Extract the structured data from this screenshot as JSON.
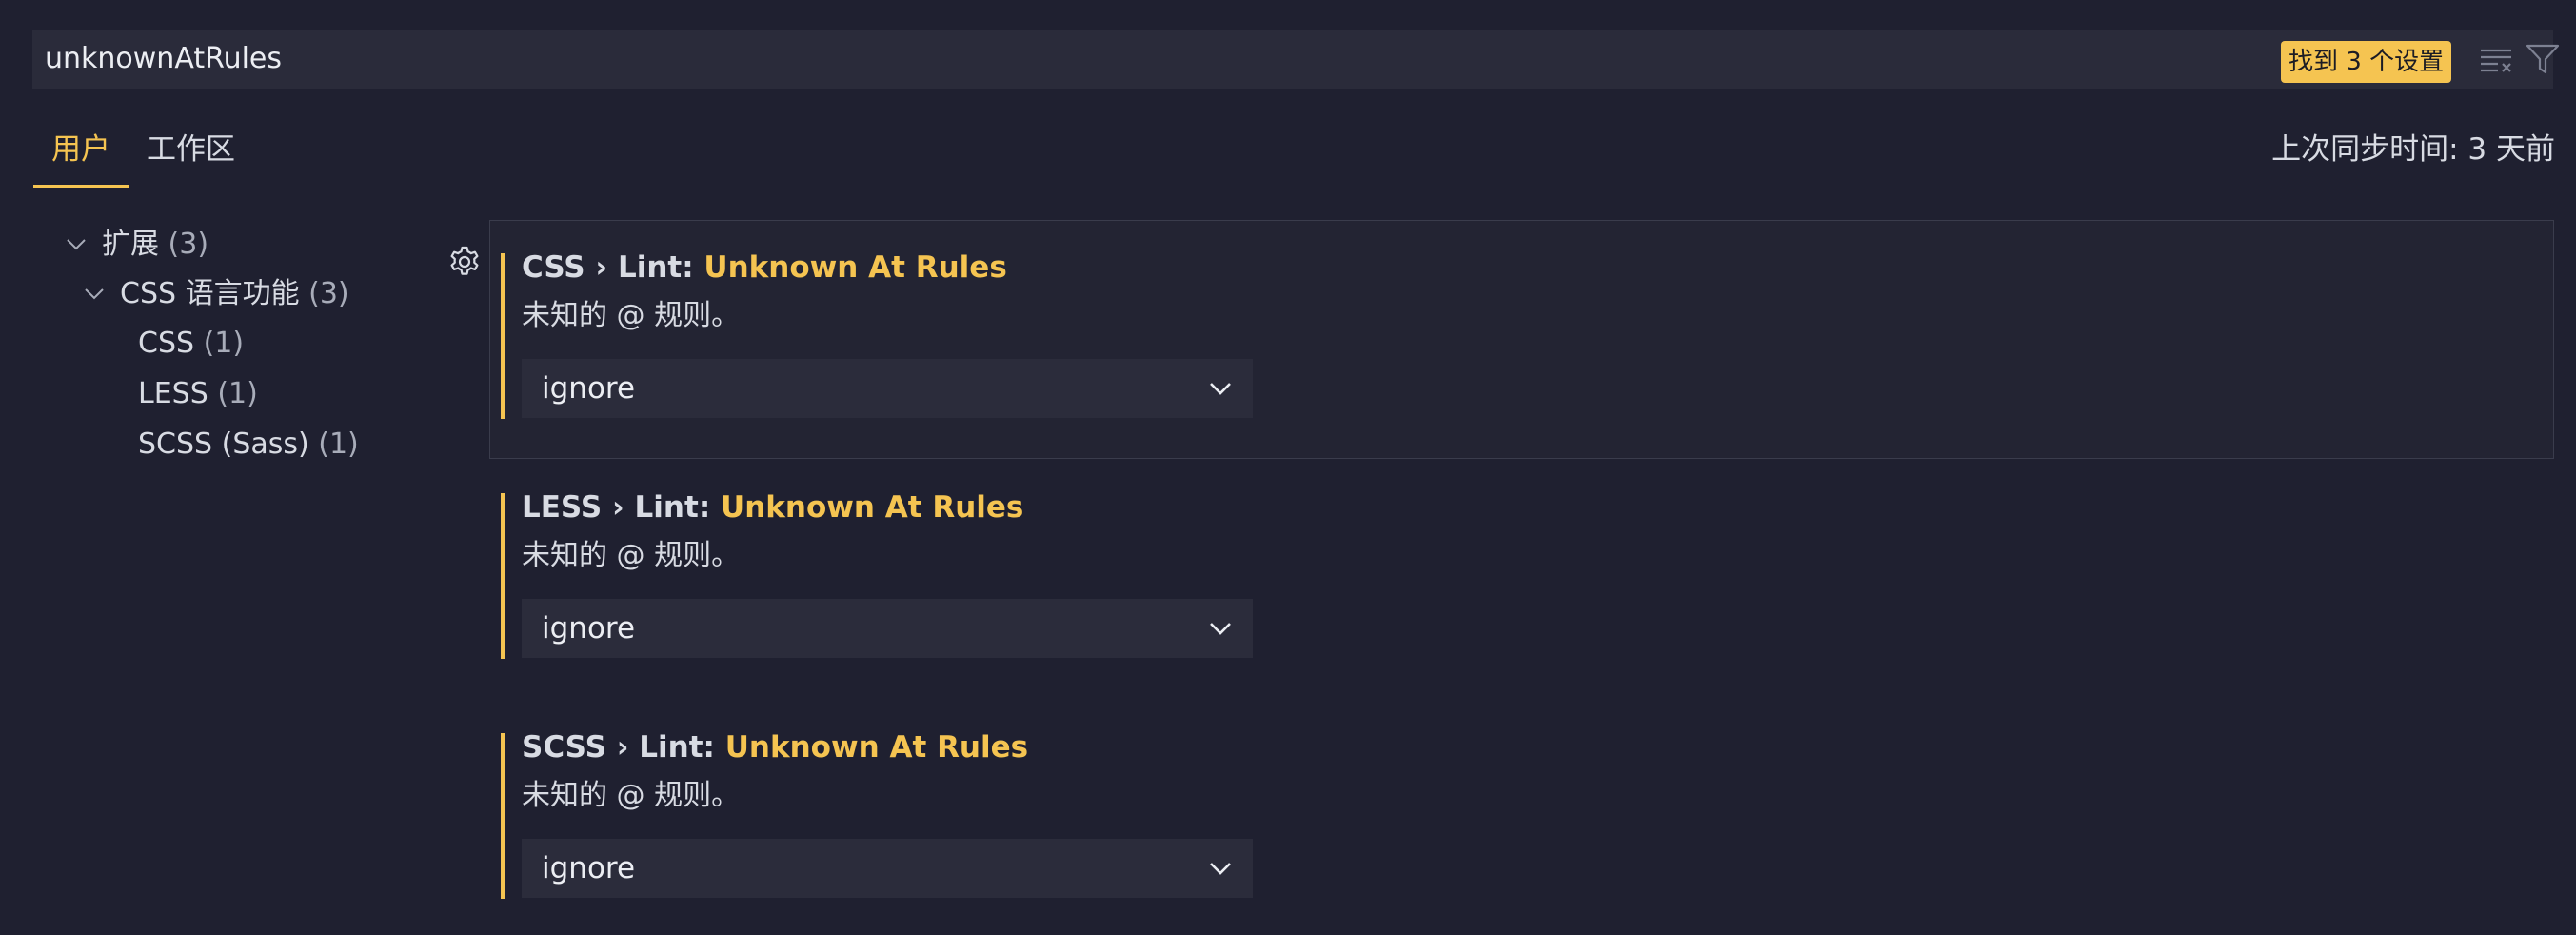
{
  "search": {
    "value": "unknownAtRules",
    "result_badge": "找到 3 个设置",
    "clear_icon": "clear-filter-icon",
    "filter_icon": "filter-icon"
  },
  "tabs": {
    "user": "用户",
    "workspace": "工作区",
    "active": "user"
  },
  "sync_status": "上次同步时间: 3 天前",
  "tree": {
    "extensions": {
      "label": "扩展",
      "count": "(3)"
    },
    "css_lang": {
      "label": "CSS 语言功能",
      "count": "(3)"
    },
    "items": [
      {
        "label": "CSS",
        "count": "(1)"
      },
      {
        "label": "LESS",
        "count": "(1)"
      },
      {
        "label": "SCSS (Sass)",
        "count": "(1)"
      }
    ]
  },
  "settings": [
    {
      "prefix": "CSS › Lint: ",
      "name": "Unknown At Rules",
      "description": "未知的 @ 规则。",
      "value": "ignore"
    },
    {
      "prefix": "LESS › Lint: ",
      "name": "Unknown At Rules",
      "description": "未知的 @ 规则。",
      "value": "ignore"
    },
    {
      "prefix": "SCSS › Lint: ",
      "name": "Unknown At Rules",
      "description": "未知的 @ 规则。",
      "value": "ignore"
    }
  ],
  "colors": {
    "background": "#1f2030",
    "accent": "#f5c451",
    "input_bg": "#2a2b3a",
    "text": "#d8dbe3"
  }
}
